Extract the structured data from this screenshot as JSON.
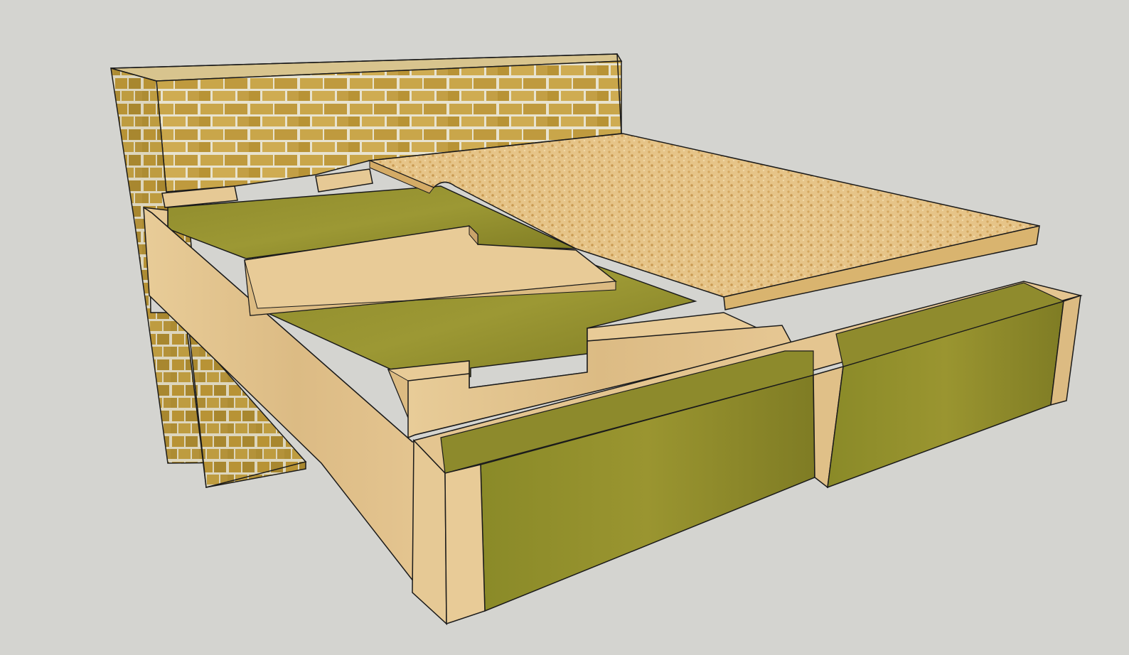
{
  "scene": {
    "background_color": "#d4d4d0",
    "colors": {
      "brick": "#c9a64a",
      "brick_dark": "#a8872f",
      "mortar": "#e8e3cf",
      "timber": "#e4c48e",
      "timber_dark": "#c9a36a",
      "insulation": "#8e8a2a",
      "insulation_dark": "#6f6d1e",
      "chipboard": "#e6c488",
      "chipboard_dark": "#c9a462",
      "edge": "#1a1a1a"
    },
    "components": [
      {
        "id": "brick-wall",
        "icon": "brick-wall-icon"
      },
      {
        "id": "timber-joist",
        "icon": "timber-joist-icon"
      },
      {
        "id": "mineral-wool-insulation",
        "icon": "insulation-icon"
      },
      {
        "id": "chipboard-panel",
        "icon": "chipboard-icon"
      }
    ]
  }
}
